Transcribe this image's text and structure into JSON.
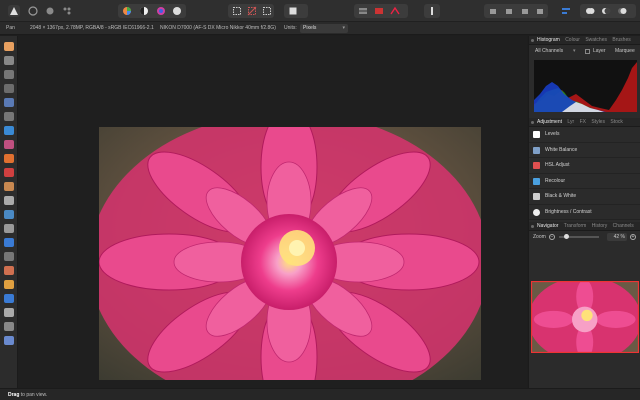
{
  "context": {
    "persona_label": "Pan",
    "doc_info": "2048 × 1367px, 2.78MP, RGBA/8 - sRGB IEC61966-2.1",
    "camera_info": "NIKON D7000 (AF-S DX Micro Nikkor 40mm f/2.8G)",
    "units_label": "Units:",
    "units_value": "Pixels"
  },
  "panels": {
    "histogram_tabs": [
      "Histogram",
      "Colour",
      "Swatches",
      "Brushes"
    ],
    "channels_select": "All Channels",
    "layer_label": "Layer",
    "marquee_label": "Marquee",
    "adjustment_tabs": [
      "Adjustment",
      "Lyr",
      "FX",
      "Styles",
      "Stock"
    ],
    "adjustments": [
      {
        "label": "Levels",
        "icon": "levels-icon",
        "color": "#ffffff"
      },
      {
        "label": "White Balance",
        "icon": "white-balance-icon",
        "color": "#7fa0c8"
      },
      {
        "label": "HSL Adjust",
        "icon": "hsl-icon",
        "color": "#e05050"
      },
      {
        "label": "Recolour",
        "icon": "recolour-icon",
        "color": "#4aa0e0"
      },
      {
        "label": "Black & White",
        "icon": "black-white-icon",
        "color": "#d0d0d0"
      },
      {
        "label": "Brightness / Contrast",
        "icon": "brightness-icon",
        "color": "#f0f0f0"
      }
    ],
    "navigator_tabs": [
      "Navigator",
      "Transform",
      "History",
      "Channels"
    ],
    "zoom_label": "Zoom",
    "zoom_value": "42 %"
  },
  "status": {
    "bold": "Drag",
    "text": "to pan view."
  },
  "colors": {
    "accent": "#3a7bd5",
    "petal": "#e8347a",
    "center": "#f4d35e"
  }
}
